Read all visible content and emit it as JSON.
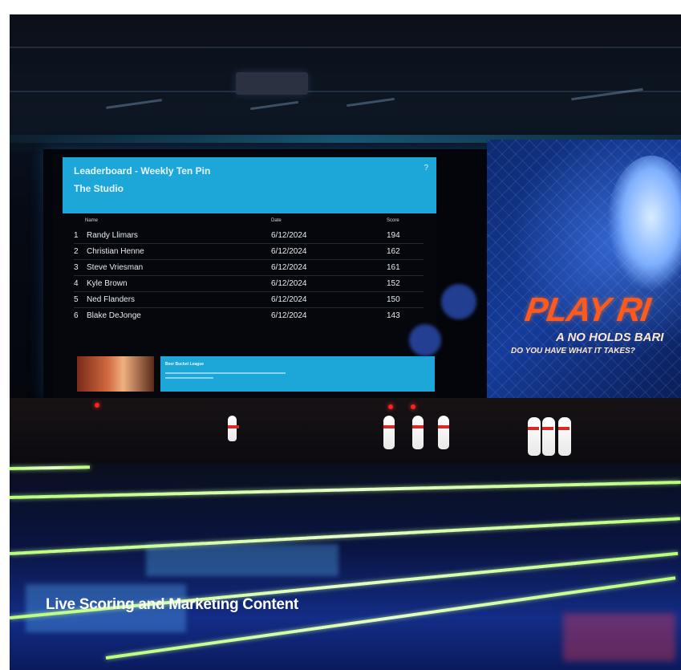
{
  "caption": "Live Scoring and Marketing Content",
  "leaderboard": {
    "title": "Leaderboard - Weekly Ten Pin",
    "subtitle": "The Studio",
    "columns": {
      "name": "Name",
      "date": "Date",
      "score": "Score"
    },
    "rows": [
      {
        "rank": "1",
        "name": "Randy Llimars",
        "date": "6/12/2024",
        "score": "194"
      },
      {
        "rank": "2",
        "name": "Christian Henne",
        "date": "6/12/2024",
        "score": "162"
      },
      {
        "rank": "3",
        "name": "Steve Vriesman",
        "date": "6/12/2024",
        "score": "161"
      },
      {
        "rank": "4",
        "name": "Kyle Brown",
        "date": "6/12/2024",
        "score": "152"
      },
      {
        "rank": "5",
        "name": "Ned Flanders",
        "date": "6/12/2024",
        "score": "150"
      },
      {
        "rank": "6",
        "name": "Blake DeJonge",
        "date": "6/12/2024",
        "score": "143"
      }
    ],
    "promo_title": "Beer Bucket League"
  },
  "graphic": {
    "headline": "PLAY RI",
    "line1": "A NO HOLDS BARI",
    "line2": "DO YOU HAVE WHAT IT TAKES?"
  },
  "colors": {
    "accent_cyan": "#1da7d8",
    "gutter_glow": "#b8ff7a",
    "headline_orange": "#ff5a1e"
  }
}
